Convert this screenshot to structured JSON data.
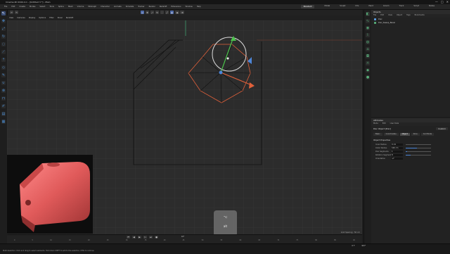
{
  "window": {
    "title": "Cinema 4D 2024.4.1 - [Untitled 3 *] - Main",
    "controls": [
      "—",
      "□",
      "✕"
    ]
  },
  "menubar": {
    "items": [
      "File",
      "Edit",
      "Create",
      "Modes",
      "Select",
      "Tools",
      "Spline",
      "Mesh",
      "Volume",
      "MoGraph",
      "Character",
      "Animate",
      "Simulate",
      "Tracker",
      "Render",
      "Redshift",
      "Extensions",
      "Window",
      "Help"
    ],
    "layouts": [
      "Standard",
      "Model",
      "Sculpt",
      "UVs",
      "Paint",
      "Groom",
      "Track",
      "Script",
      "Nodes"
    ],
    "active_layout": "Standard"
  },
  "toolbar": {
    "icons": [
      "undo-icon",
      "redo-icon",
      "live-selection-icon",
      "move-icon",
      "scale-icon",
      "rotate-icon",
      "points-mode-icon",
      "edges-mode-icon",
      "polygons-mode-icon",
      "model-mode-icon",
      "snap-icon",
      "render-view-icon",
      "render-settings-icon"
    ]
  },
  "viewport": {
    "menu": [
      "View",
      "Cameras",
      "Display",
      "Options",
      "Filter",
      "Panel",
      "Redshift"
    ],
    "info": "Grid Spacing : 50 cm"
  },
  "left_tools": {
    "icons": [
      "select-icon",
      "move-icon",
      "scale-icon",
      "rotate-icon",
      "live-select-icon",
      "knife-icon",
      "extrude-icon",
      "bevel-icon",
      "brush-icon",
      "magnet-icon",
      "weld-icon",
      "bridge-icon",
      "polygon-pen-icon",
      "paint-icon",
      "uv-icon"
    ]
  },
  "key_overlay": {
    "symbol": "⌥",
    "label": "alt"
  },
  "timeline": {
    "ticks": [
      "0",
      "5",
      "10",
      "15",
      "20",
      "25",
      "30",
      "35",
      "40",
      "45",
      "50",
      "55",
      "60",
      "65",
      "70",
      "75",
      "80",
      "85",
      "90"
    ],
    "current_frame": "0 F"
  },
  "statusbar": {
    "message": "Multi-Selection: Click and drag to select elements. Hold down SHIFT to add to the selection, CTRL to remove.",
    "start_frame": "0 F",
    "end_frame": "90 F"
  },
  "objects_panel": {
    "title": "Objects",
    "menu": [
      "File",
      "Edit",
      "View",
      "Object",
      "Tags",
      "Bookmarks"
    ],
    "rows": [
      "Disc",
      "Disc_Sweep_Bevel"
    ]
  },
  "attributes_panel": {
    "title": "Attributes",
    "menu": [
      "Mode",
      "Edit",
      "User Data"
    ],
    "object_label": "Disc Object [Disc]",
    "preset": "Custom",
    "tabs": [
      "Basic",
      "Coordinates",
      "Object",
      "Slice",
      "Cull Mode"
    ],
    "active_tab": "Object",
    "section": "Object Properties",
    "props": [
      {
        "label": "Inner Radius",
        "value": "0 cm",
        "fill": 0
      },
      {
        "label": "Outer Radius",
        "value": "100 cm",
        "fill": 0.45
      },
      {
        "label": "Disc Segments",
        "value": "1",
        "fill": 0.05
      },
      {
        "label": "Rotation Segments",
        "value": "8",
        "fill": 0.2
      },
      {
        "label": "Orientation",
        "value": "+Y",
        "fill": 0
      }
    ]
  },
  "colors": {
    "accent": "#4d86d8",
    "selection": "#e0603a",
    "model": "#e05a5a"
  }
}
